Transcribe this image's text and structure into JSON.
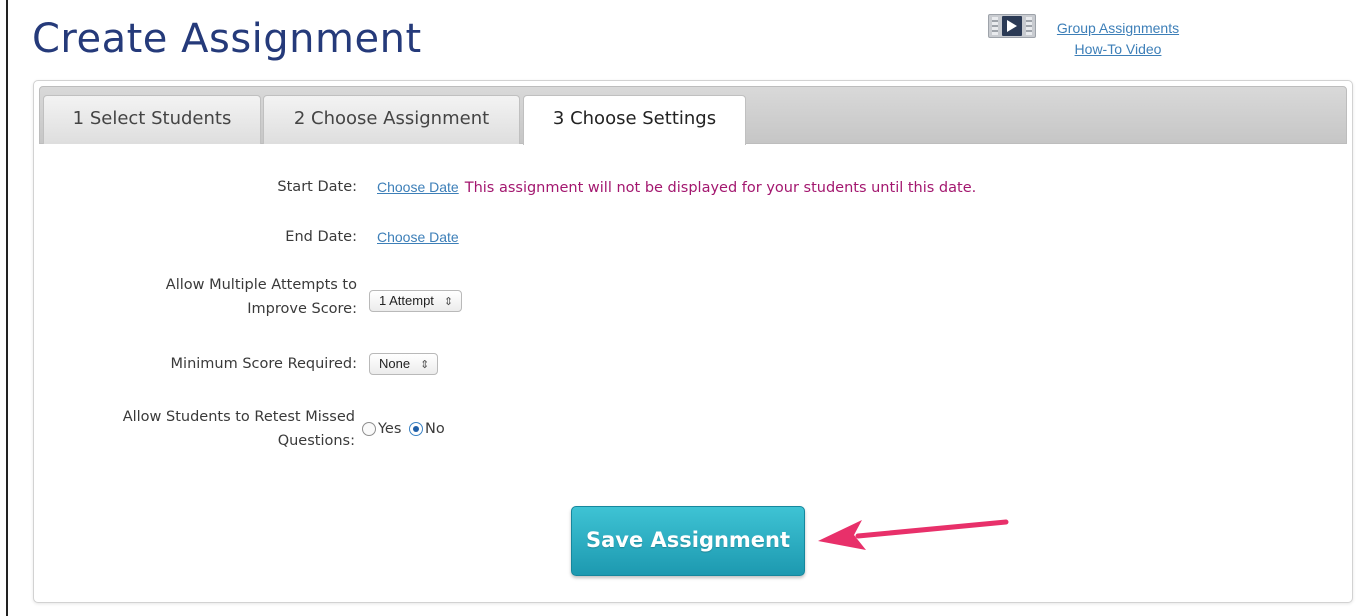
{
  "page": {
    "title": "Create Assignment"
  },
  "video_link": {
    "line1": "Group Assignments",
    "line2": "How-To Video"
  },
  "tabs": [
    {
      "label": "1 Select Students",
      "active": false
    },
    {
      "label": "2 Choose Assignment",
      "active": false
    },
    {
      "label": "3 Choose Settings",
      "active": true
    }
  ],
  "form": {
    "start_date": {
      "label": "Start Date:",
      "link": "Choose Date",
      "note": "This assignment will not be displayed for your students until this date."
    },
    "end_date": {
      "label": "End Date:",
      "link": "Choose Date"
    },
    "attempts": {
      "label_line1": "Allow Multiple Attempts to",
      "label_line2": "Improve Score:",
      "selected": "1 Attempt"
    },
    "min_score": {
      "label": "Minimum Score Required:",
      "selected": "None"
    },
    "retest": {
      "label_line1": "Allow Students to Retest Missed",
      "label_line2": "Questions:",
      "options": [
        "Yes",
        "No"
      ],
      "selected": "No"
    }
  },
  "save_button": {
    "label": "Save Assignment"
  },
  "colors": {
    "title": "#253a7a",
    "link": "#3d7fb8",
    "note": "#a3176f",
    "button": "#2aafc3",
    "arrow": "#e8306a"
  },
  "icons": {
    "video": "film-play-icon",
    "annotation": "pink-arrow-icon"
  }
}
